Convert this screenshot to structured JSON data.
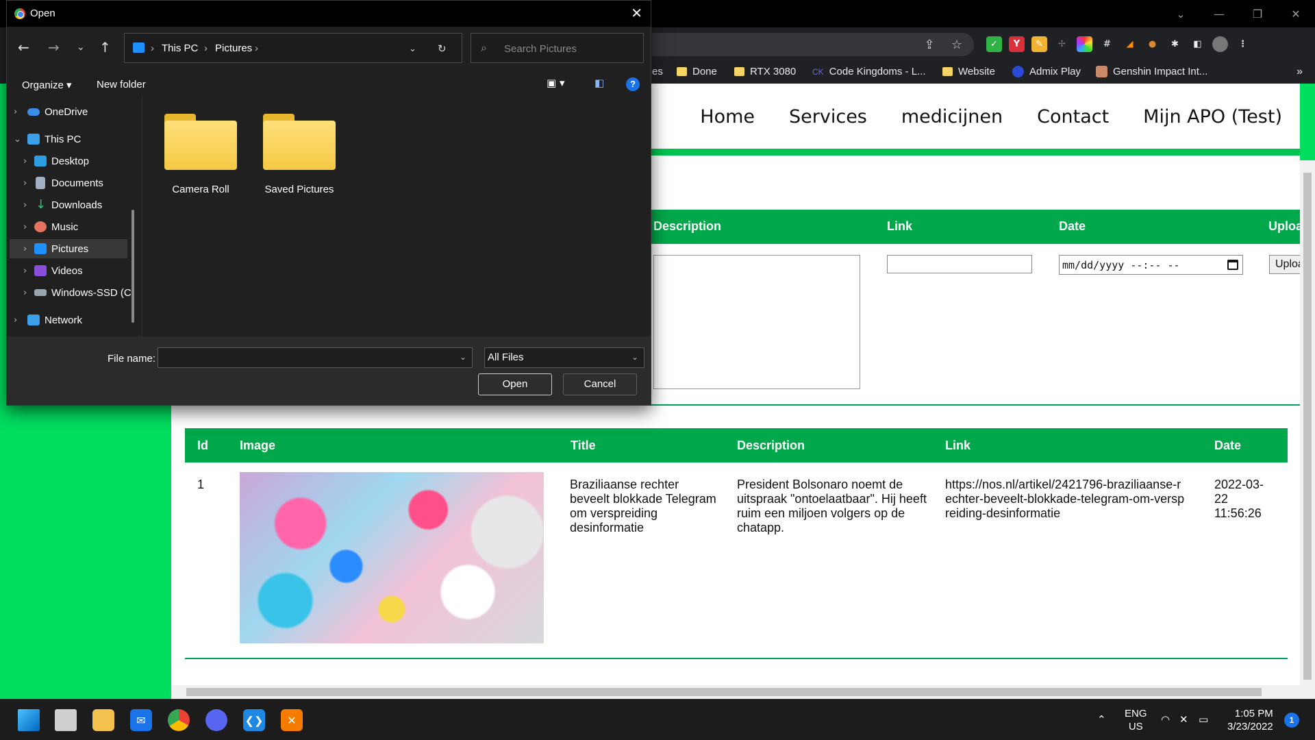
{
  "browser": {
    "bookmarks": [
      {
        "label": "es"
      },
      {
        "label": "Done"
      },
      {
        "label": "RTX 3080"
      },
      {
        "label": "Code Kingdoms - L..."
      },
      {
        "label": "Website"
      },
      {
        "label": "Admix Play"
      },
      {
        "label": "Genshin Impact Int..."
      }
    ],
    "more_bookmarks": "»"
  },
  "page": {
    "nav": [
      "Home",
      "Services",
      "medicijnen",
      "Contact",
      "Mijn APO (Test)"
    ],
    "form": {
      "headers": {
        "description": "Description",
        "link": "Link",
        "date": "Date",
        "upload": "Uploa"
      },
      "date_placeholder": "mm/dd/yyyy --:-- --",
      "upload_label": "Uploa"
    },
    "table": {
      "headers": {
        "id": "Id",
        "image": "Image",
        "title": "Title",
        "description": "Description",
        "link": "Link",
        "date": "Date"
      },
      "rows": [
        {
          "id": "1",
          "title": "Braziliaanse rechter beveelt blokkade Telegram om verspreiding desinformatie",
          "description": "President Bolsonaro noemt de uitspraak \"ontoelaatbaar\". Hij heeft ruim een miljoen volgers op de chatapp.",
          "link": "https://nos.nl/artikel/2421796-braziliaanse-rechter-beveelt-blokkade-telegram-om-verspreiding-desinformatie",
          "date": "2022-03-22 11:56:26"
        }
      ]
    }
  },
  "dialog": {
    "title": "Open",
    "breadcrumb": [
      "This PC",
      "Pictures"
    ],
    "search_placeholder": "Search Pictures",
    "commands": {
      "organize": "Organize",
      "new_folder": "New folder",
      "help": "?"
    },
    "sidebar": [
      {
        "label": "OneDrive"
      },
      {
        "label": "This PC"
      },
      {
        "label": "Desktop"
      },
      {
        "label": "Documents"
      },
      {
        "label": "Downloads"
      },
      {
        "label": "Music"
      },
      {
        "label": "Pictures"
      },
      {
        "label": "Videos"
      },
      {
        "label": "Windows-SSD (C"
      },
      {
        "label": "Network"
      }
    ],
    "folders": [
      "Camera Roll",
      "Saved Pictures"
    ],
    "file_name_label": "File name:",
    "file_name_value": "",
    "file_type": "All Files",
    "buttons": {
      "open": "Open",
      "cancel": "Cancel"
    }
  },
  "taskbar": {
    "lang": "ENG",
    "region": "US",
    "time": "1:05 PM",
    "date": "3/23/2022",
    "notifications": "1"
  }
}
